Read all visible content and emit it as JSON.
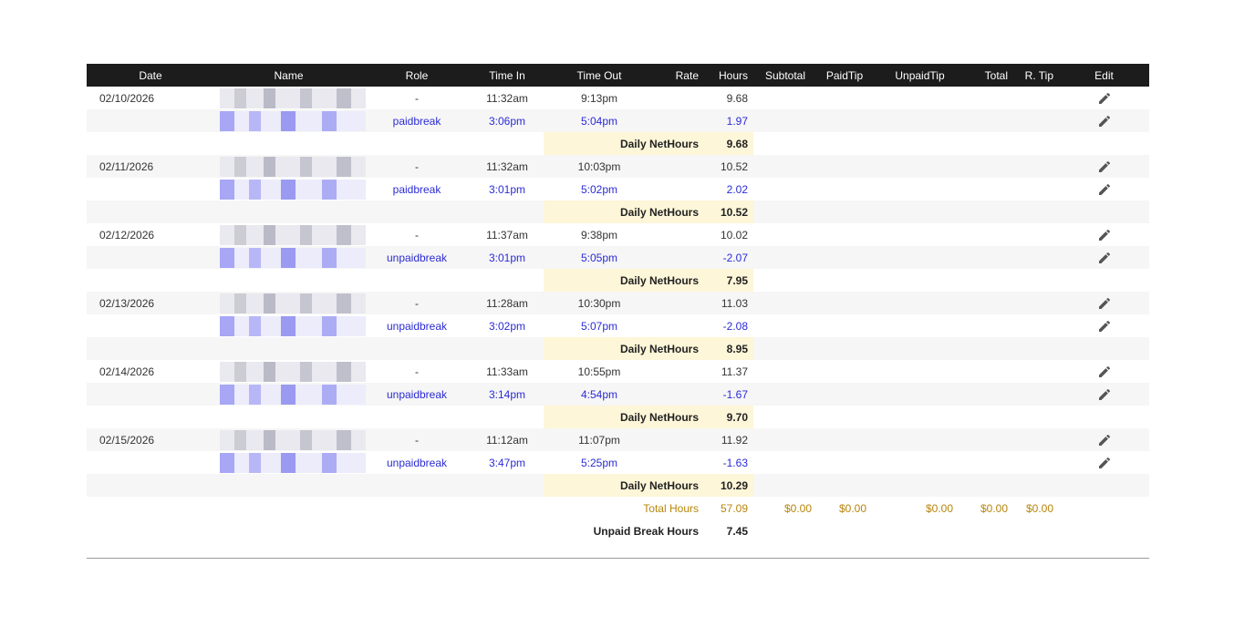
{
  "headers": {
    "date": "Date",
    "name": "Name",
    "role": "Role",
    "time_in": "Time In",
    "time_out": "Time Out",
    "rate": "Rate",
    "hours": "Hours",
    "subtotal": "Subtotal",
    "paid_tip": "PaidTip",
    "unpaid_tip": "UnpaidTip",
    "total": "Total",
    "r_tip": "R. Tip",
    "edit": "Edit"
  },
  "days": [
    {
      "date": "02/10/2026",
      "shift": {
        "role": "-",
        "time_in": "11:32am",
        "time_out": "9:13pm",
        "hours": "9.68"
      },
      "break": {
        "role": "paidbreak",
        "time_in": "3:06pm",
        "time_out": "5:04pm",
        "hours": "1.97"
      },
      "daily_label": "Daily NetHours",
      "daily_net": "9.68"
    },
    {
      "date": "02/11/2026",
      "shift": {
        "role": "-",
        "time_in": "11:32am",
        "time_out": "10:03pm",
        "hours": "10.52"
      },
      "break": {
        "role": "paidbreak",
        "time_in": "3:01pm",
        "time_out": "5:02pm",
        "hours": "2.02"
      },
      "daily_label": "Daily NetHours",
      "daily_net": "10.52"
    },
    {
      "date": "02/12/2026",
      "shift": {
        "role": "-",
        "time_in": "11:37am",
        "time_out": "9:38pm",
        "hours": "10.02"
      },
      "break": {
        "role": "unpaidbreak",
        "time_in": "3:01pm",
        "time_out": "5:05pm",
        "hours": "-2.07"
      },
      "daily_label": "Daily NetHours",
      "daily_net": "7.95"
    },
    {
      "date": "02/13/2026",
      "shift": {
        "role": "-",
        "time_in": "11:28am",
        "time_out": "10:30pm",
        "hours": "11.03"
      },
      "break": {
        "role": "unpaidbreak",
        "time_in": "3:02pm",
        "time_out": "5:07pm",
        "hours": "-2.08"
      },
      "daily_label": "Daily NetHours",
      "daily_net": "8.95"
    },
    {
      "date": "02/14/2026",
      "shift": {
        "role": "-",
        "time_in": "11:33am",
        "time_out": "10:55pm",
        "hours": "11.37"
      },
      "break": {
        "role": "unpaidbreak",
        "time_in": "3:14pm",
        "time_out": "4:54pm",
        "hours": "-1.67"
      },
      "daily_label": "Daily NetHours",
      "daily_net": "9.70"
    },
    {
      "date": "02/15/2026",
      "shift": {
        "role": "-",
        "time_in": "11:12am",
        "time_out": "11:07pm",
        "hours": "11.92"
      },
      "break": {
        "role": "unpaidbreak",
        "time_in": "3:47pm",
        "time_out": "5:25pm",
        "hours": "-1.63"
      },
      "daily_label": "Daily NetHours",
      "daily_net": "10.29"
    }
  ],
  "totals": {
    "label": "Total Hours",
    "hours": "57.09",
    "subtotal": "$0.00",
    "paid_tip": "$0.00",
    "unpaid_tip": "$0.00",
    "total": "$0.00",
    "r_tip": "$0.00"
  },
  "unpaid_break": {
    "label": "Unpaid Break Hours",
    "hours": "7.45"
  },
  "icons": {
    "edit": "pencil-icon",
    "name_redacted": "pixelated-name"
  },
  "colors": {
    "header_bg": "#1c1c1c",
    "break_text": "#2b2bd6",
    "daily_bg": "#fdf6d8",
    "total_text": "#b8860b"
  }
}
